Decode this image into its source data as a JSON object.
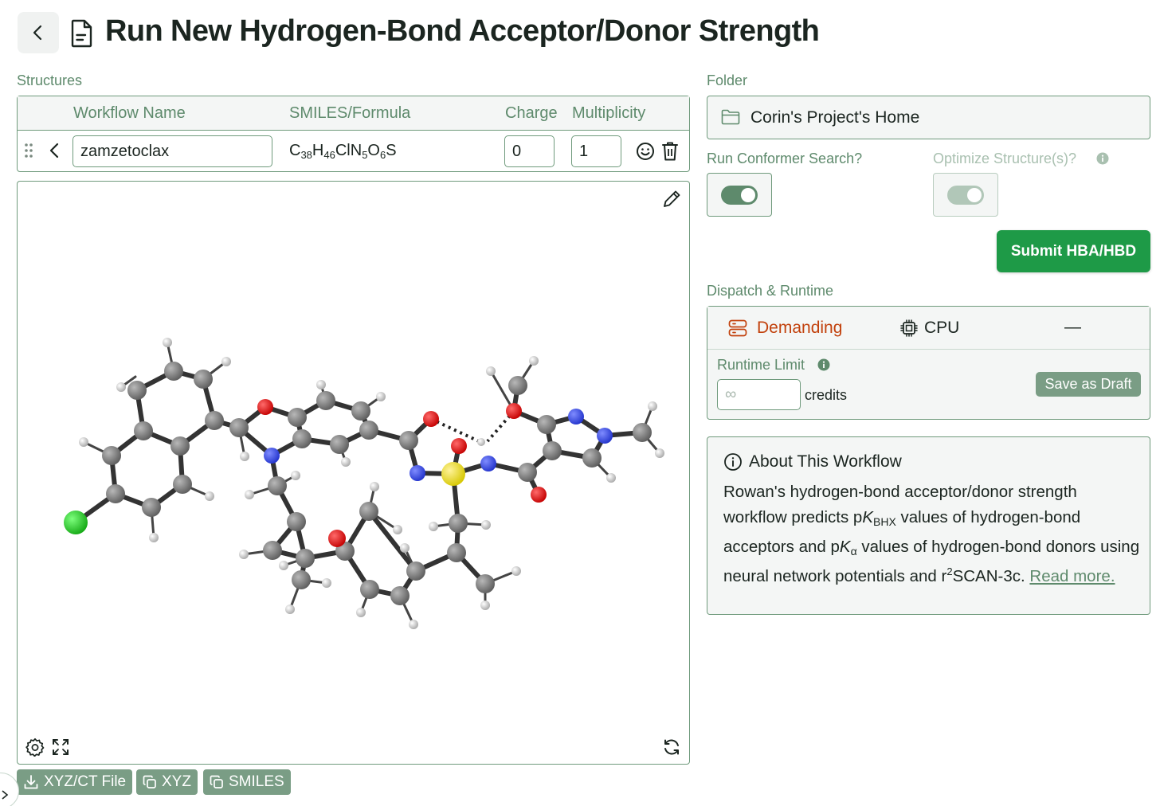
{
  "header": {
    "title": "Run New Hydrogen-Bond Acceptor/Donor Strength"
  },
  "structures": {
    "label": "Structures",
    "columns": {
      "name": "Workflow Name",
      "smiles": "SMILES/Formula",
      "charge": "Charge",
      "multiplicity": "Multiplicity"
    },
    "row": {
      "name": "zamzetoclax",
      "formula": {
        "C": "C",
        "C_n": "38",
        "H": "H",
        "H_n": "46",
        "ClN": "ClN",
        "N_n": "5",
        "O": "O",
        "O_n": "6",
        "S": "S"
      },
      "charge": "0",
      "multiplicity": "1"
    }
  },
  "viewer": {
    "buttons": {
      "xyz_file": "XYZ/CT File",
      "xyz": "XYZ",
      "smiles": "SMILES"
    }
  },
  "folder": {
    "label": "Folder",
    "value": "Corin's Project's Home"
  },
  "options": {
    "conformer_label": "Run Conformer Search?",
    "conformer_on": true,
    "optimize_label": "Optimize Structure(s)?",
    "optimize_on": true,
    "optimize_disabled": true
  },
  "submit": {
    "label": "Submit HBA/HBD"
  },
  "dispatch": {
    "label": "Dispatch & Runtime",
    "tier": "Demanding",
    "tier_color": "#c2410c",
    "hardware": "CPU",
    "dash": "—",
    "runtime_label": "Runtime Limit",
    "runtime_placeholder": "∞",
    "units": "credits",
    "save_draft": "Save as Draft"
  },
  "about": {
    "title": "About This Workflow",
    "t1": "Rowan's hydrogen-bond acceptor/donor strength workflow predicts p",
    "k1": "K",
    "s1": "BHX",
    "t2": " values of hydrogen-bond acceptors and p",
    "k2": "K",
    "s2": "α",
    "t3": " values of hydrogen-bond donors using neural network potentials and r",
    "sup": "2",
    "t4": "SCAN-3c. ",
    "link": "Read more."
  },
  "colors": {
    "accent": "#5e8a6c",
    "border": "#6f9a7c",
    "primary_button": "#1e9a47",
    "secondary_button": "#7a9d85"
  }
}
